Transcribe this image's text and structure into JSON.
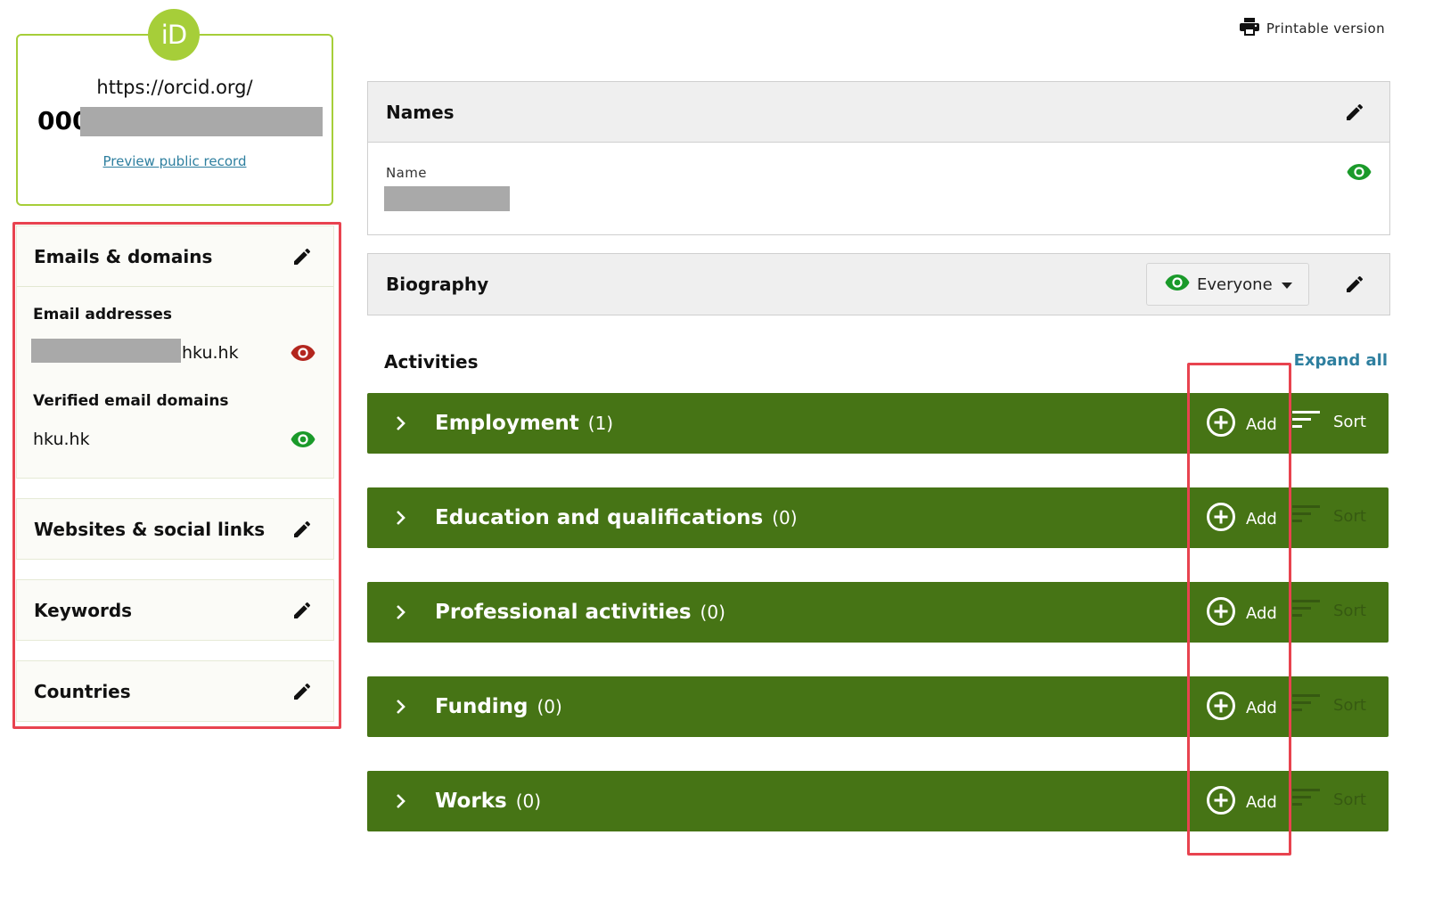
{
  "orcid": {
    "logo_text": "iD",
    "url_prefix": "https://orcid.org/",
    "id_visible_prefix": "000",
    "preview_link": "Preview public record",
    "brand_color": "#a6ce39"
  },
  "sidebar": {
    "emails_domains": {
      "title": "Emails & domains",
      "email_addresses_label": "Email addresses",
      "email_suffix": "hku.hk",
      "email_visibility": "private",
      "verified_domains_label": "Verified email domains",
      "domain": "hku.hk",
      "domain_visibility": "everyone"
    },
    "websites": {
      "title": "Websites & social links"
    },
    "keywords": {
      "title": "Keywords"
    },
    "countries": {
      "title": "Countries"
    }
  },
  "toolbar": {
    "printable": "Printable version"
  },
  "names": {
    "title": "Names",
    "name_label": "Name",
    "visibility": "everyone"
  },
  "biography": {
    "title": "Biography",
    "visibility_label": "Everyone"
  },
  "activities": {
    "title": "Activities",
    "expand_all": "Expand all",
    "add_label": "Add",
    "sort_label": "Sort",
    "sections": [
      {
        "title": "Employment",
        "count": "(1)",
        "sort_enabled": true
      },
      {
        "title": "Education and qualifications",
        "count": "(0)",
        "sort_enabled": false
      },
      {
        "title": "Professional activities",
        "count": "(0)",
        "sort_enabled": false
      },
      {
        "title": "Funding",
        "count": "(0)",
        "sort_enabled": false
      },
      {
        "title": "Works",
        "count": "(0)",
        "sort_enabled": false
      }
    ]
  },
  "colors": {
    "activity_bar": "#467415",
    "link": "#2e7f9f",
    "eye_public": "#1a9a2a",
    "eye_private": "#b3261e",
    "highlight_box": "#e8434f"
  }
}
